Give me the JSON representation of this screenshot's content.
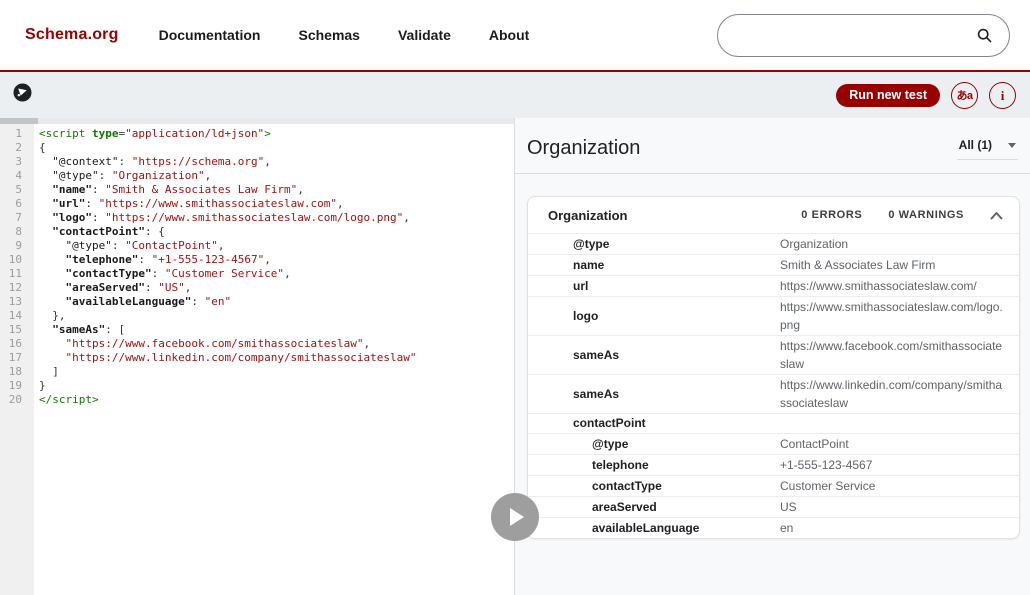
{
  "header": {
    "logo": "Schema.org",
    "nav": [
      "Documentation",
      "Schemas",
      "Validate",
      "About"
    ],
    "search_placeholder": ""
  },
  "toolbar": {
    "run_label": "Run new test",
    "lang_icon_text": "あa",
    "info_icon_text": "i"
  },
  "editor": {
    "lines": [
      [
        [
          "tag",
          "<script"
        ],
        [
          "plain",
          " "
        ],
        [
          "attr",
          "type"
        ],
        [
          "plain",
          "="
        ],
        [
          "str",
          "\"application/ld+json\""
        ],
        [
          "tag",
          ">"
        ]
      ],
      [
        [
          "plain",
          "{"
        ]
      ],
      [
        [
          "plain",
          "  "
        ],
        [
          "atkey",
          "\"@context\""
        ],
        [
          "plain",
          ": "
        ],
        [
          "str",
          "\"https://schema.org\""
        ],
        [
          "plain",
          ","
        ]
      ],
      [
        [
          "plain",
          "  "
        ],
        [
          "atkey",
          "\"@type\""
        ],
        [
          "plain",
          ": "
        ],
        [
          "str",
          "\"Organization\""
        ],
        [
          "plain",
          ","
        ]
      ],
      [
        [
          "plain",
          "  "
        ],
        [
          "key",
          "\"name\""
        ],
        [
          "plain",
          ": "
        ],
        [
          "str",
          "\"Smith & Associates Law Firm\""
        ],
        [
          "plain",
          ","
        ]
      ],
      [
        [
          "plain",
          "  "
        ],
        [
          "key",
          "\"url\""
        ],
        [
          "plain",
          ": "
        ],
        [
          "str",
          "\"https://www.smithassociateslaw.com\""
        ],
        [
          "plain",
          ","
        ]
      ],
      [
        [
          "plain",
          "  "
        ],
        [
          "key",
          "\"logo\""
        ],
        [
          "plain",
          ": "
        ],
        [
          "str",
          "\"https://www.smithassociateslaw.com/logo.png\""
        ],
        [
          "plain",
          ","
        ]
      ],
      [
        [
          "plain",
          "  "
        ],
        [
          "key",
          "\"contactPoint\""
        ],
        [
          "plain",
          ": {"
        ]
      ],
      [
        [
          "plain",
          "    "
        ],
        [
          "atkey",
          "\"@type\""
        ],
        [
          "plain",
          ": "
        ],
        [
          "str",
          "\"ContactPoint\""
        ],
        [
          "plain",
          ","
        ]
      ],
      [
        [
          "plain",
          "    "
        ],
        [
          "key",
          "\"telephone\""
        ],
        [
          "plain",
          ": "
        ],
        [
          "str",
          "\"+1-555-123-4567\""
        ],
        [
          "plain",
          ","
        ]
      ],
      [
        [
          "plain",
          "    "
        ],
        [
          "key",
          "\"contactType\""
        ],
        [
          "plain",
          ": "
        ],
        [
          "str",
          "\"Customer Service\""
        ],
        [
          "plain",
          ","
        ]
      ],
      [
        [
          "plain",
          "    "
        ],
        [
          "key",
          "\"areaServed\""
        ],
        [
          "plain",
          ": "
        ],
        [
          "str",
          "\"US\""
        ],
        [
          "plain",
          ","
        ]
      ],
      [
        [
          "plain",
          "    "
        ],
        [
          "key",
          "\"availableLanguage\""
        ],
        [
          "plain",
          ": "
        ],
        [
          "str",
          "\"en\""
        ]
      ],
      [
        [
          "plain",
          "  },"
        ]
      ],
      [
        [
          "plain",
          "  "
        ],
        [
          "key",
          "\"sameAs\""
        ],
        [
          "plain",
          ": ["
        ]
      ],
      [
        [
          "plain",
          "    "
        ],
        [
          "str",
          "\"https://www.facebook.com/smithassociateslaw\""
        ],
        [
          "plain",
          ","
        ]
      ],
      [
        [
          "plain",
          "    "
        ],
        [
          "str",
          "\"https://www.linkedin.com/company/smithassociateslaw\""
        ]
      ],
      [
        [
          "plain",
          "  ]"
        ]
      ],
      [
        [
          "plain",
          "}"
        ]
      ],
      [
        [
          "tag",
          "</script>"
        ]
      ]
    ]
  },
  "results": {
    "title": "Organization",
    "filter": "All (1)",
    "card": {
      "title": "Organization",
      "errors": "0 ERRORS",
      "warnings": "0 WARNINGS",
      "rows": [
        {
          "prop": "@type",
          "value": "Organization",
          "indent": 0
        },
        {
          "prop": "name",
          "value": "Smith & Associates Law Firm",
          "indent": 0
        },
        {
          "prop": "url",
          "value": "https://www.smithassociateslaw.com/",
          "indent": 0
        },
        {
          "prop": "logo",
          "value": "https://www.smithassociateslaw.com/logo.png",
          "indent": 0
        },
        {
          "prop": "sameAs",
          "value": "https://www.facebook.com/smithassociateslaw",
          "indent": 0
        },
        {
          "prop": "sameAs",
          "value": "https://www.linkedin.com/company/smithassociateslaw",
          "indent": 0
        },
        {
          "prop": "contactPoint",
          "value": "",
          "indent": 0
        },
        {
          "prop": "@type",
          "value": "ContactPoint",
          "indent": 1
        },
        {
          "prop": "telephone",
          "value": "+1-555-123-4567",
          "indent": 1
        },
        {
          "prop": "contactType",
          "value": "Customer Service",
          "indent": 1
        },
        {
          "prop": "areaServed",
          "value": "US",
          "indent": 1
        },
        {
          "prop": "availableLanguage",
          "value": "en",
          "indent": 1
        }
      ]
    }
  },
  "colors": {
    "brand_red": "#990000",
    "toolbar_bg": "#eceff1",
    "code_string": "#a31111",
    "code_tag": "#117700"
  }
}
